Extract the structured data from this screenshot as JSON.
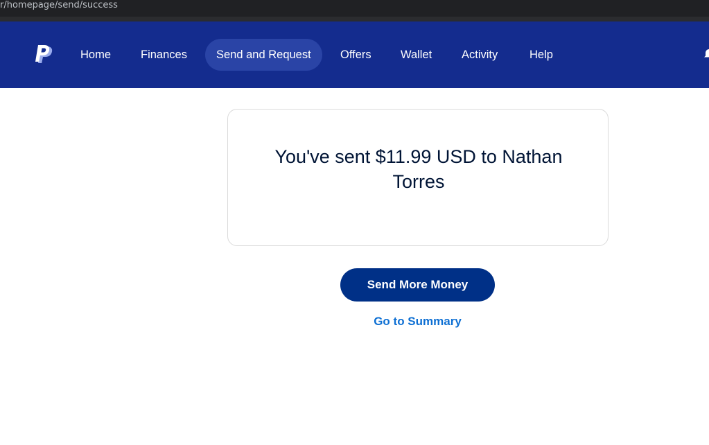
{
  "browser": {
    "url": "r/homepage/send/success"
  },
  "nav": {
    "logo": "paypal-logo",
    "items": [
      {
        "label": "Home",
        "active": false
      },
      {
        "label": "Finances",
        "active": false
      },
      {
        "label": "Send and Request",
        "active": true
      },
      {
        "label": "Offers",
        "active": false
      },
      {
        "label": "Wallet",
        "active": false
      },
      {
        "label": "Activity",
        "active": false
      },
      {
        "label": "Help",
        "active": false
      }
    ]
  },
  "confirmation": {
    "message": "You've sent $11.99 USD to Nathan Torres"
  },
  "actions": {
    "send_more_label": "Send More Money",
    "summary_link_label": "Go to Summary"
  },
  "colors": {
    "nav_bg": "#142c8e",
    "active_pill": "#2a44a6",
    "primary_button": "#003087",
    "link": "#0d6fd3",
    "text_dark": "#001435"
  }
}
